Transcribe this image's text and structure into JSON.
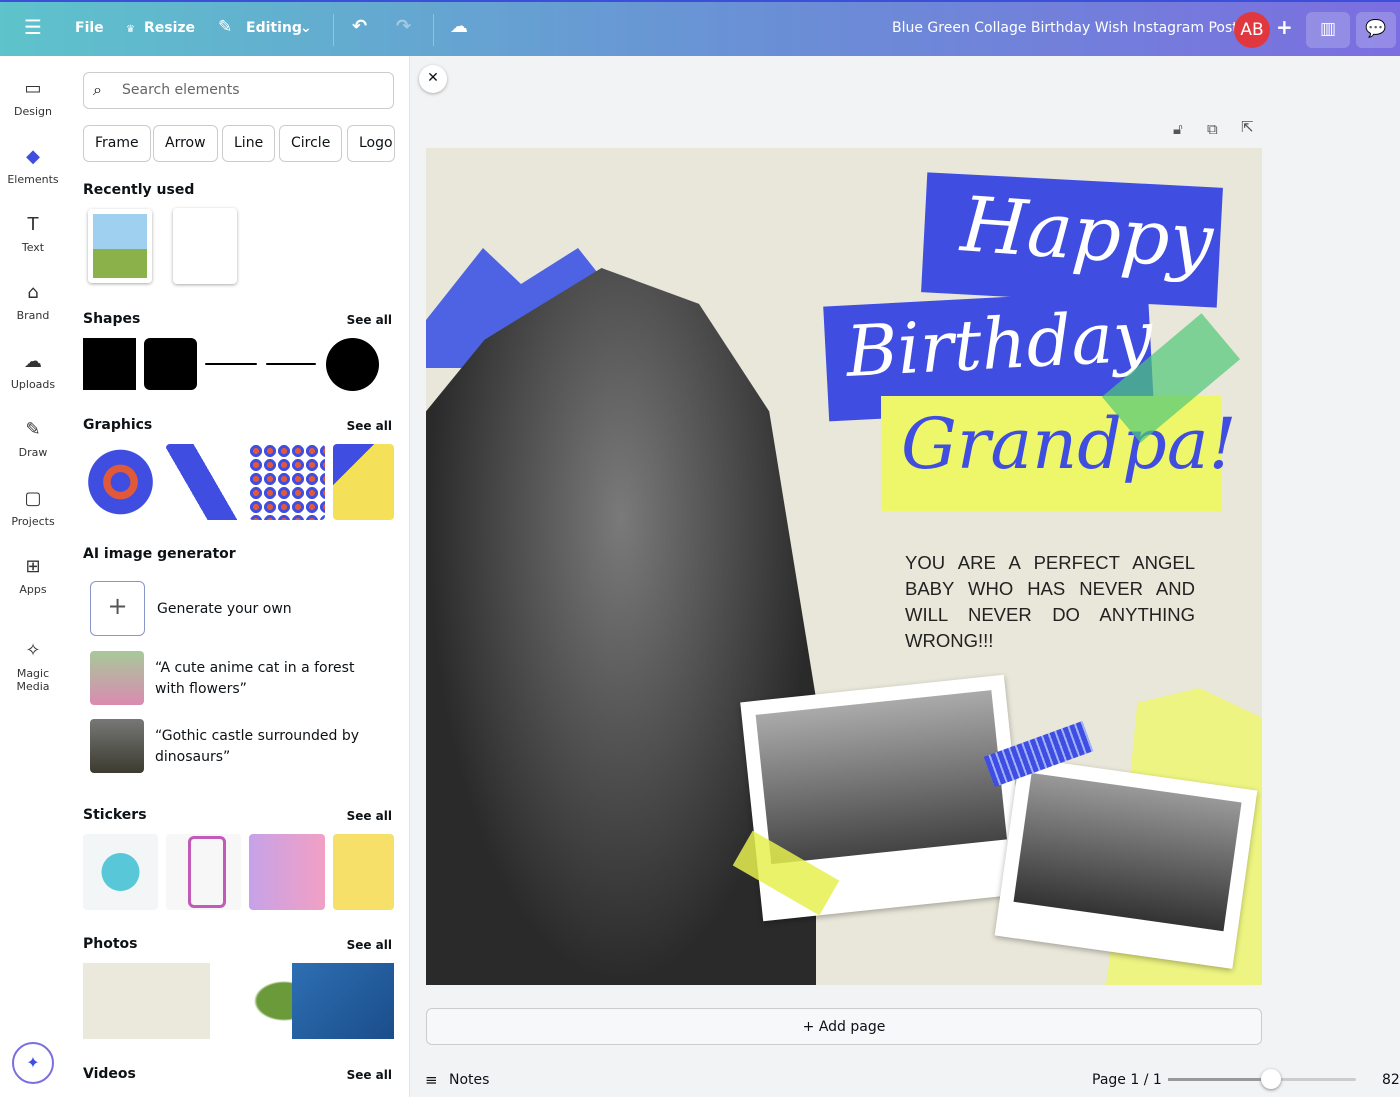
{
  "topbar": {
    "file": "File",
    "resize": "Resize",
    "editing": "Editing",
    "title": "Blue Green Collage Birthday Wish Instagram Post",
    "avatar": "AB"
  },
  "rail": [
    {
      "label": "Design",
      "icon": "design-icon"
    },
    {
      "label": "Elements",
      "icon": "elements-icon"
    },
    {
      "label": "Text",
      "icon": "text-icon"
    },
    {
      "label": "Brand",
      "icon": "brand-icon"
    },
    {
      "label": "Uploads",
      "icon": "uploads-icon"
    },
    {
      "label": "Draw",
      "icon": "draw-icon"
    },
    {
      "label": "Projects",
      "icon": "projects-icon"
    },
    {
      "label": "Apps",
      "icon": "apps-icon"
    },
    {
      "label": "Magic Media",
      "icon": "magic-media-icon"
    }
  ],
  "panel": {
    "search_placeholder": "Search elements",
    "chips": [
      "Frame",
      "Arrow",
      "Line",
      "Circle",
      "Logo"
    ],
    "recently_used": "Recently used",
    "shapes": "Shapes",
    "graphics": "Graphics",
    "ai": "AI image generator",
    "generate": "Generate your own",
    "prompts": [
      "“A cute anime cat in a forest with flowers”",
      "“Gothic castle surrounded by dinosaurs”"
    ],
    "stickers": "Stickers",
    "photos": "Photos",
    "videos": "Videos",
    "see_all": "See all"
  },
  "poster": {
    "line1": "Happy",
    "line2": "Birthday",
    "line3": "Grandpa!",
    "message": "YOU ARE A PERFECT ANGEL BABY WHO HAS NEVER AND WILL NEVER DO ANYTHING WRONG!!!"
  },
  "footer": {
    "add_page": "+ Add page",
    "notes": "Notes",
    "page": "Page 1 / 1",
    "zoom": "82%",
    "zoom_level": 0.55
  },
  "colors": {
    "accent": "#3f4de0",
    "yellow": "#eef76a"
  }
}
